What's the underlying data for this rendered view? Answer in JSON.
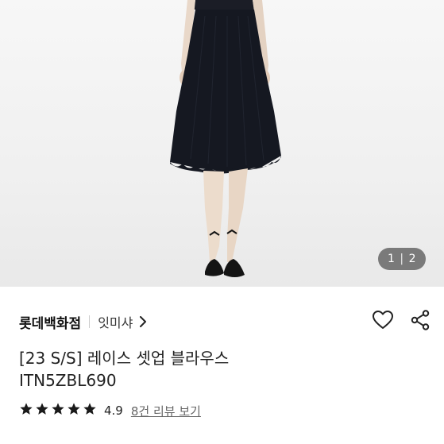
{
  "gallery": {
    "current_page": "1",
    "separator": "|",
    "total_pages": "2"
  },
  "store": {
    "name": "롯데백화점",
    "brand": "잇미샤"
  },
  "product": {
    "title_line1": "[23 S/S] 레이스 셋업 블라우스",
    "title_line2": "ITN5ZBL690"
  },
  "rating": {
    "stars": 5,
    "score": "4.9",
    "review_link": "8건 리뷰 보기"
  },
  "icons": {
    "brand_chevron": "chevron-right-icon",
    "like": "heart-icon",
    "share": "share-icon",
    "star": "star-icon"
  },
  "colors": {
    "star": "#1a1a1a",
    "pager_bg": "#5a5a5a"
  }
}
